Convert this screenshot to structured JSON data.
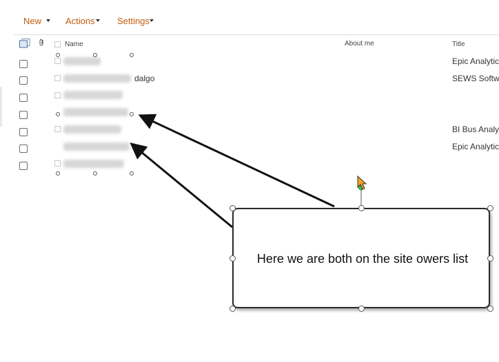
{
  "toolbar": {
    "new_label": "New",
    "actions_label": "Actions",
    "settings_label": "Settings",
    "accent_color": "#c55a11"
  },
  "list": {
    "columns": {
      "name": "Name",
      "about_me": "About me",
      "title": "Title"
    },
    "rows": [
      {
        "title": "Epic Analytics"
      },
      {
        "name_partial": "dalgo",
        "title": "SEWS Softwa"
      },
      {
        "title": ""
      },
      {
        "title": ""
      },
      {
        "title": "BI Bus Analys"
      },
      {
        "title": "Epic Analytics"
      },
      {
        "title": ""
      }
    ]
  },
  "annotation": {
    "callout_text": "Here we are both on the site owers list"
  }
}
